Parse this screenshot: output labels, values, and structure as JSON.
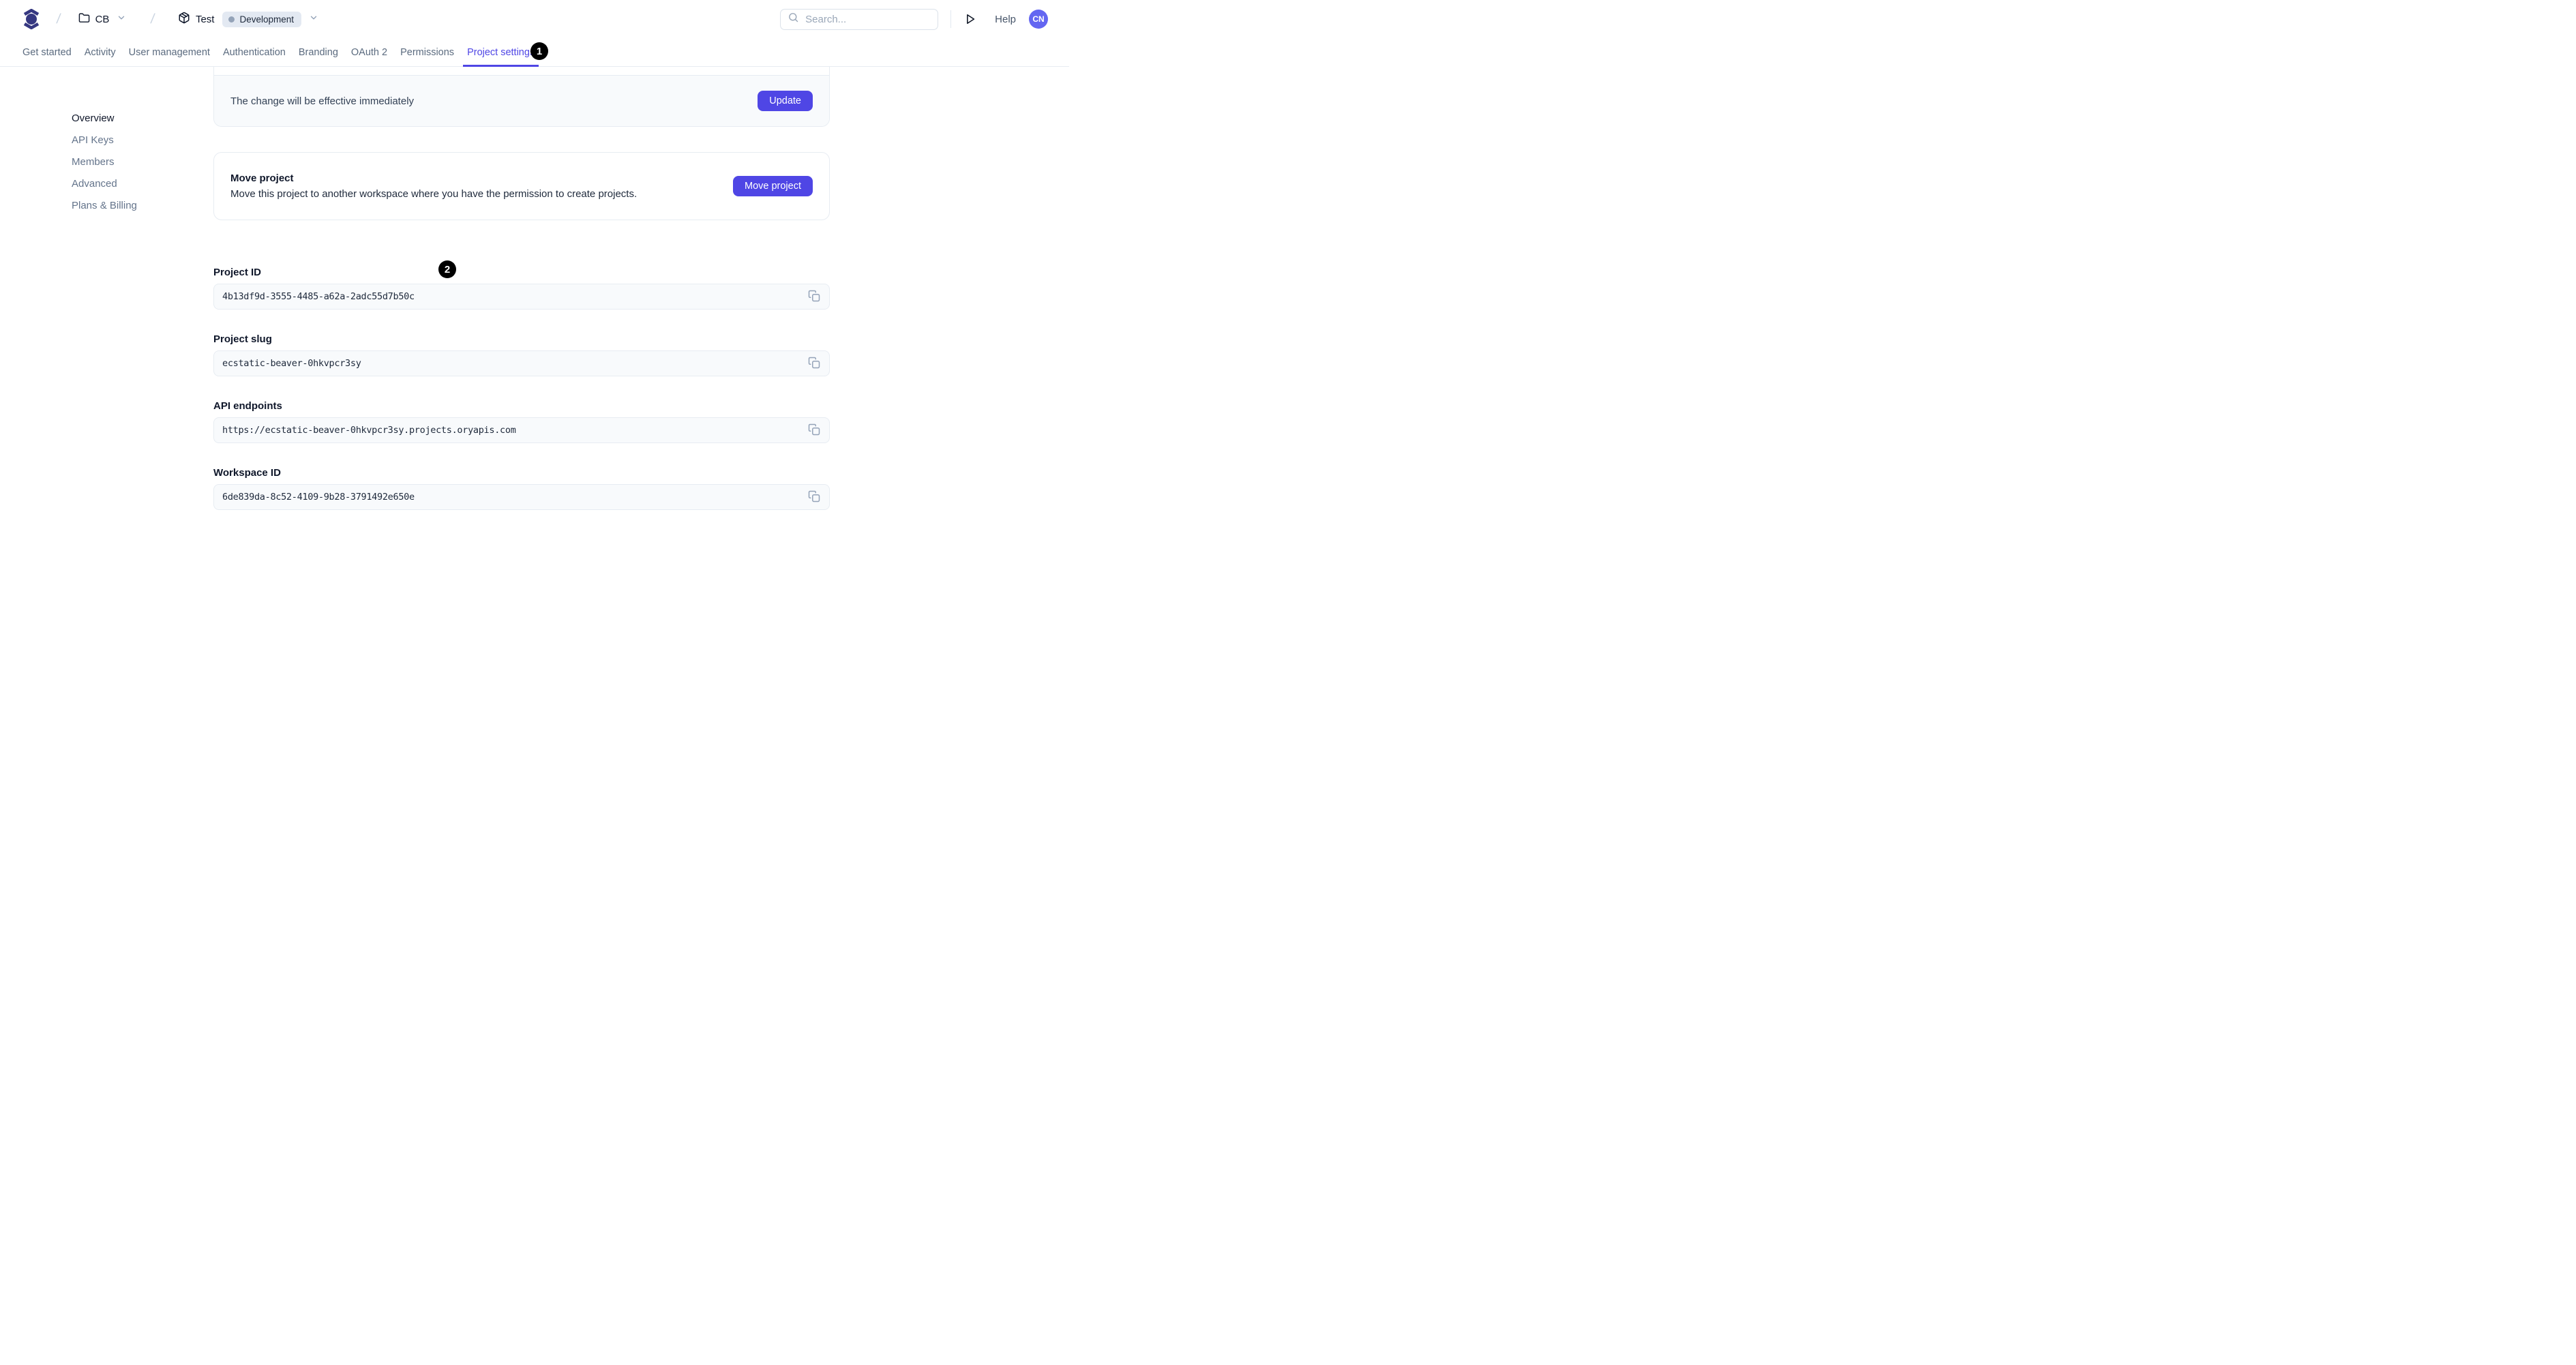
{
  "header": {
    "breadcrumb": {
      "separator": "/",
      "workspace": {
        "label": "CB"
      },
      "project": {
        "label": "Test",
        "environment_badge": "Development"
      }
    },
    "search": {
      "placeholder": "Search..."
    },
    "help_label": "Help",
    "avatar_initials": "CN"
  },
  "tabs": {
    "items": [
      {
        "label": "Get started",
        "active": false
      },
      {
        "label": "Activity",
        "active": false
      },
      {
        "label": "User management",
        "active": false
      },
      {
        "label": "Authentication",
        "active": false
      },
      {
        "label": "Branding",
        "active": false
      },
      {
        "label": "OAuth 2",
        "active": false
      },
      {
        "label": "Permissions",
        "active": false
      },
      {
        "label": "Project settings",
        "active": true
      }
    ]
  },
  "sidebar": {
    "items": [
      {
        "label": "Overview",
        "active": true
      },
      {
        "label": "API Keys",
        "active": false
      },
      {
        "label": "Members",
        "active": false
      },
      {
        "label": "Advanced",
        "active": false
      },
      {
        "label": "Plans & Billing",
        "active": false
      }
    ]
  },
  "main": {
    "update_card": {
      "message": "The change will be effective immediately",
      "button_label": "Update"
    },
    "move_card": {
      "title": "Move project",
      "description": "Move this project to another workspace where you have the permission to create projects.",
      "button_label": "Move project"
    },
    "fields": [
      {
        "label": "Project ID",
        "value": "4b13df9d-3555-4485-a62a-2adc55d7b50c"
      },
      {
        "label": "Project slug",
        "value": "ecstatic-beaver-0hkvpcr3sy"
      },
      {
        "label": "API endpoints",
        "value": "https://ecstatic-beaver-0hkvpcr3sy.projects.oryapis.com"
      },
      {
        "label": "Workspace ID",
        "value": "6de839da-8c52-4109-9b28-3791492e650e"
      }
    ]
  },
  "annotations": {
    "badge1": "1",
    "badge2": "2"
  },
  "icons": {
    "logo": "ory-logo",
    "workspace": "folder-icon",
    "project": "package-icon",
    "search": "search-icon",
    "run": "play-icon",
    "copy": "copy-icon",
    "dropdown": "chevron-down-icon"
  },
  "colors": {
    "accent": "#4f46e5",
    "logo": "#363881",
    "avatar_bg": "#6366f1",
    "badge_bg": "#e3e9f2",
    "field_bg": "#f8fafc",
    "border": "#e7ecf2",
    "annotation": "#000000"
  }
}
